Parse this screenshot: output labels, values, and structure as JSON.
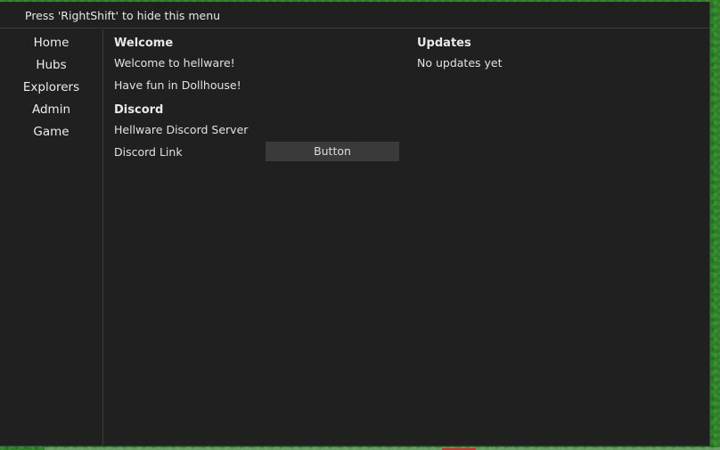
{
  "window": {
    "hint": "Press 'RightShift' to hide this menu"
  },
  "sidebar": {
    "items": [
      {
        "label": "Home"
      },
      {
        "label": "Hubs"
      },
      {
        "label": "Explorers"
      },
      {
        "label": "Admin"
      },
      {
        "label": "Game"
      }
    ]
  },
  "welcome": {
    "title": "Welcome",
    "line1": "Welcome to hellware!",
    "line2": "Have fun in Dollhouse!"
  },
  "discord": {
    "title": "Discord",
    "server_label": "Hellware Discord Server",
    "link_label": "Discord Link",
    "button_label": "Button"
  },
  "updates": {
    "title": "Updates",
    "text": "No updates yet"
  }
}
